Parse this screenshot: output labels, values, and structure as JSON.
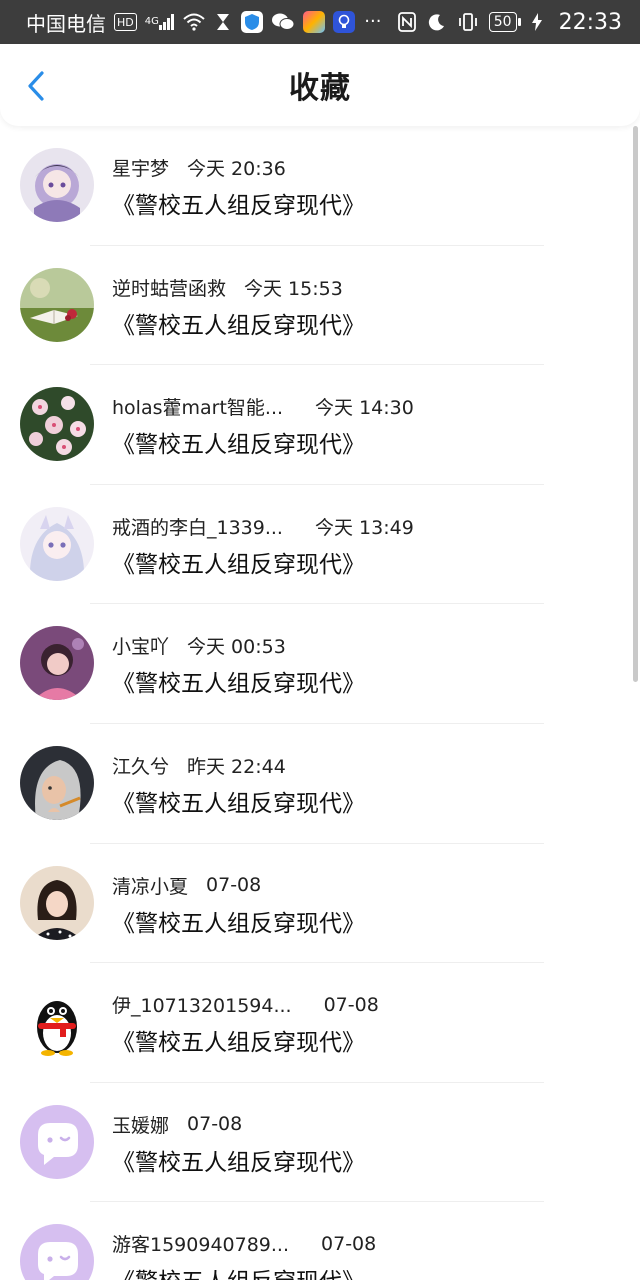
{
  "status_bar": {
    "carrier": "中国电信",
    "hd": "HD",
    "signal": "4G",
    "battery": "50",
    "time": "22:33"
  },
  "header": {
    "title": "收藏"
  },
  "colors": {
    "accent": "#2a8de8",
    "status_bar_bg": "#3d3d3d"
  },
  "items": [
    {
      "name": "星宇梦",
      "time": "今天 20:36",
      "book": "《警校五人组反穿现代》",
      "avatar": "anime-girl-avatar"
    },
    {
      "name": "逆时蛄营函救",
      "time": "今天 15:53",
      "book": "《警校五人组反穿现代》",
      "avatar": "book-grass-avatar"
    },
    {
      "name": "holas藿mart智能...",
      "time": "今天 14:30",
      "book": "《警校五人组反穿现代》",
      "avatar": "flowers-avatar"
    },
    {
      "name": "戒酒的李白_1339...",
      "time": "今天 13:49",
      "book": "《警校五人组反穿现代》",
      "avatar": "anime-girl-avatar"
    },
    {
      "name": "小宝吖",
      "time": "今天 00:53",
      "book": "《警校五人组反穿现代》",
      "avatar": "girl-photo-avatar"
    },
    {
      "name": "江久兮",
      "time": "昨天 22:44",
      "book": "《警校五人组反穿现代》",
      "avatar": "anime-portrait-avatar"
    },
    {
      "name": "清凉小夏",
      "time": "07-08",
      "book": "《警校五人组反穿现代》",
      "avatar": "girl-photo-avatar"
    },
    {
      "name": "伊_10713201594...",
      "time": "07-08",
      "book": "《警校五人组反穿现代》",
      "avatar": "penguin-avatar"
    },
    {
      "name": "玉媛娜",
      "time": "07-08",
      "book": "《警校五人组反穿现代》",
      "avatar": "default-chat-avatar"
    },
    {
      "name": "游客1590940789...",
      "time": "07-08",
      "book": "《警校五人组反穿现代》",
      "avatar": "default-chat-avatar"
    }
  ]
}
